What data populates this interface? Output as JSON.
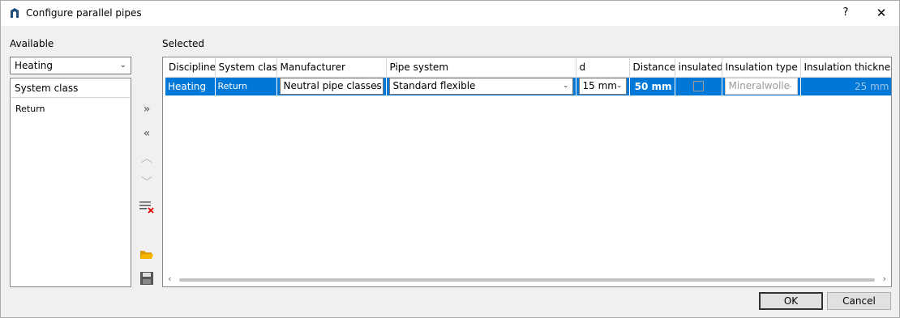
{
  "window": {
    "title": "Configure parallel pipes",
    "help": "?",
    "close": "✕"
  },
  "available": {
    "label": "Available",
    "discipline": "Heating",
    "list_header": "System class",
    "items": [
      "Return"
    ]
  },
  "selected": {
    "label": "Selected",
    "columns": [
      "Discipline",
      "System class",
      "Manufacturer",
      "Pipe system",
      "d",
      "Distance",
      "insulated",
      "Insulation type",
      "Insulation thickness"
    ],
    "rows": [
      {
        "discipline": "Heating",
        "system_class": "Return",
        "manufacturer": "Neutral pipe classes",
        "pipe_system": "Standard flexible",
        "d": "15 mm",
        "distance": "50 mm",
        "insulated": false,
        "insulation_type": "Mineralwolle",
        "insulation_thickness": "25 mm"
      }
    ]
  },
  "tools": {
    "add": "»",
    "remove": "«",
    "up": "︿",
    "down": "﹀"
  },
  "buttons": {
    "ok": "OK",
    "cancel": "Cancel"
  },
  "colors": {
    "selection": "#0078d7",
    "folder": "#f5b400"
  }
}
